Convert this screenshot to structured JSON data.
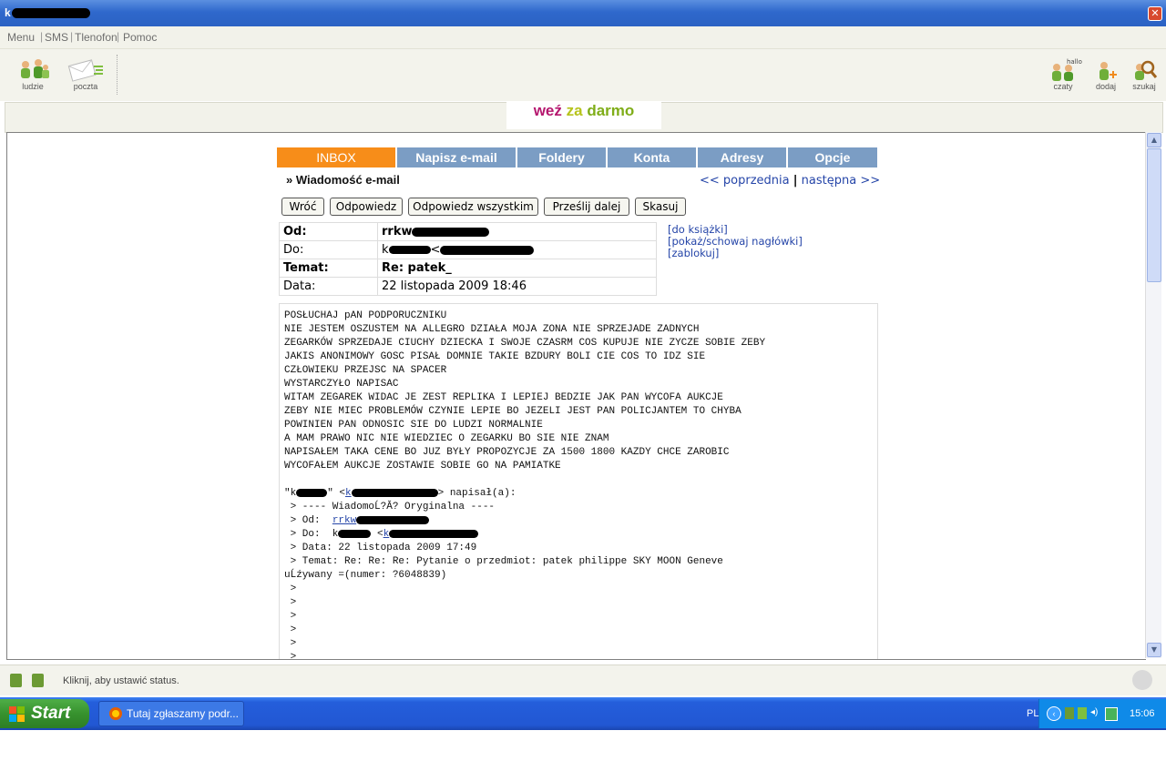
{
  "window": {
    "title": "k"
  },
  "menu": {
    "items": [
      "Menu",
      "SMS",
      "Tlenofon",
      "Pomoc"
    ]
  },
  "toolbar": {
    "left_tools": [
      {
        "label": "ludzie",
        "icon": "people-icon"
      },
      {
        "label": "poczta",
        "icon": "mail-icon"
      }
    ],
    "right_tools": [
      {
        "label": "czaty",
        "icon": "chat-people-icon",
        "badge": "hallo"
      },
      {
        "label": "dodaj",
        "icon": "add-person-icon"
      },
      {
        "label": "szukaj",
        "icon": "search-person-icon"
      }
    ]
  },
  "banner": {
    "word1": "weź",
    "word2": "za",
    "word3": "darmo"
  },
  "email": {
    "tabs": [
      "INBOX",
      "Napisz e-mail",
      "Foldery",
      "Konta",
      "Adresy",
      "Opcje"
    ],
    "active_tab": "INBOX",
    "heading": "» Wiadomość e-mail",
    "prev_label": "<< poprzednia",
    "separator": "|",
    "next_label": "następna >>",
    "actions": [
      "Wróć",
      "Odpowiedz",
      "Odpowiedz wszystkim",
      "Prześlij dalej",
      "Skasuj"
    ],
    "headers": {
      "from_label": "Od:",
      "from_value": "rrkw",
      "to_label": "Do:",
      "to_value": "k",
      "to_value_lt": "<",
      "subject_label": "Temat:",
      "subject_value": "Re: patek_",
      "date_label": "Data:",
      "date_value": "22 listopada 2009 18:46"
    },
    "side_links": [
      "[do książki]",
      "[pokaż/schowaj nagłówki]",
      "[zablokuj]"
    ],
    "body_lines": [
      "POSŁUCHAJ pAN PODPORUCZNIKU",
      "NIE JESTEM OSZUSTEM NA ALLEGRO DZIAŁA MOJA ZONA NIE SPRZEJADE ZADNYCH",
      "ZEGARKÓW SPRZEDAJE CIUCHY DZIECKA I SWOJE CZASRM COS KUPUJE NIE ZYCZE SOBIE ZEBY",
      "JAKIS ANONIMOWY GOSC PISAŁ DOMNIE TAKIE BZDURY BOLI CIE COS TO IDZ SIE",
      "CZŁOWIEKU PRZEJSC NA SPACER",
      "WYSTARCZYŁO NAPISAC",
      "WITAM ZEGAREK WIDAC JE ZEST REPLIKA I LEPIEJ BEDZIE JAK PAN WYCOFA AUKCJE",
      "ZEBY NIE MIEC PROBLEMÓW CZYNIE LEPIE BO JEZELI JEST PAN POLICJANTEM TO CHYBA",
      "POWINIEN PAN ODNOSIC SIE DO LUDZI NORMALNIE",
      "A MAM PRAWO NIC NIE WIEDZIEC O ZEGARKU BO SIE NIE ZNAM",
      "NAPISAŁEM TAKA CENE BO JUZ BYŁY PROPOZYCJE ZA 1500 1800 KAZDY CHCE ZAROBIC",
      "WYCOFAŁEM AUKCJE ZOSTAWIE SOBIE GO NA PAMIATKE"
    ],
    "quote": {
      "intro_prefix": "\"k",
      "intro_mid": "\" <",
      "intro_link": "k",
      "intro_suffix": "> napisał(a):",
      "original_header": " > ---- WiadomoĹ?Ă? Oryginalna ----",
      "from_prefix": " > Od:  ",
      "from_link": "rrkw",
      "to_prefix": " > Do:  k",
      "to_mid": " <",
      "to_link": "k",
      "date_line": " > Data: 22 listopada 2009 17:49",
      "subject_line": " > Temat: Re: Re: Re: Pytanie o przedmiot: patek philippe SKY MOON Geneve",
      "subject_cont": "uĹźywany =(numer: ?6048839)",
      "empty_lines": [
        " >",
        " >",
        " >",
        " >",
        " >",
        " >"
      ]
    }
  },
  "statusbar": {
    "text": "Kliknij, aby ustawić status."
  },
  "taskbar": {
    "start_label": "Start",
    "task_label": "Tutaj zgłaszamy podr...",
    "language": "PL",
    "clock": "15:06"
  }
}
